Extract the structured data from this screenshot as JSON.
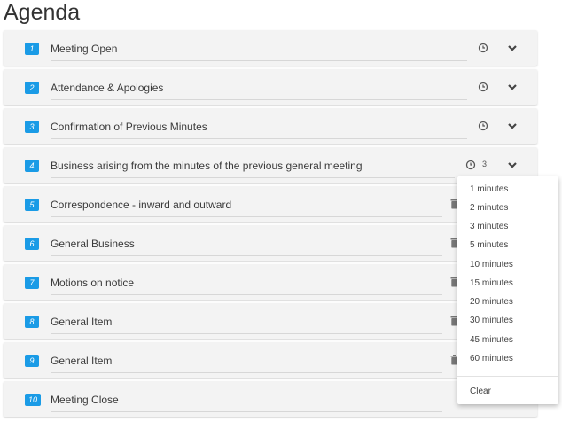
{
  "page": {
    "title": "Agenda"
  },
  "items": [
    {
      "number": "1",
      "title": "Meeting Open"
    },
    {
      "number": "2",
      "title": "Attendance & Apologies"
    },
    {
      "number": "3",
      "title": "Confirmation of Previous Minutes"
    },
    {
      "number": "4",
      "title": "Business arising from the minutes of the previous general meeting",
      "minutes": "3"
    },
    {
      "number": "5",
      "title": "Correspondence - inward and outward"
    },
    {
      "number": "6",
      "title": "General Business"
    },
    {
      "number": "7",
      "title": "Motions on notice"
    },
    {
      "number": "8",
      "title": "General Item"
    },
    {
      "number": "9",
      "title": "General Item"
    },
    {
      "number": "10",
      "title": "Meeting Close"
    }
  ],
  "duration_menu": {
    "options": [
      "1 minutes",
      "2 minutes",
      "3 minutes",
      "5 minutes",
      "10 minutes",
      "15 minutes",
      "20 minutes",
      "30 minutes",
      "45 minutes",
      "60 minutes"
    ],
    "clear_label": "Clear"
  },
  "icons": {
    "clock": "clock-icon",
    "chevron": "chevron-down-icon",
    "trash": "trash-icon"
  },
  "colors": {
    "accent": "#1a9be6",
    "item_background": "#f3f3f3"
  }
}
